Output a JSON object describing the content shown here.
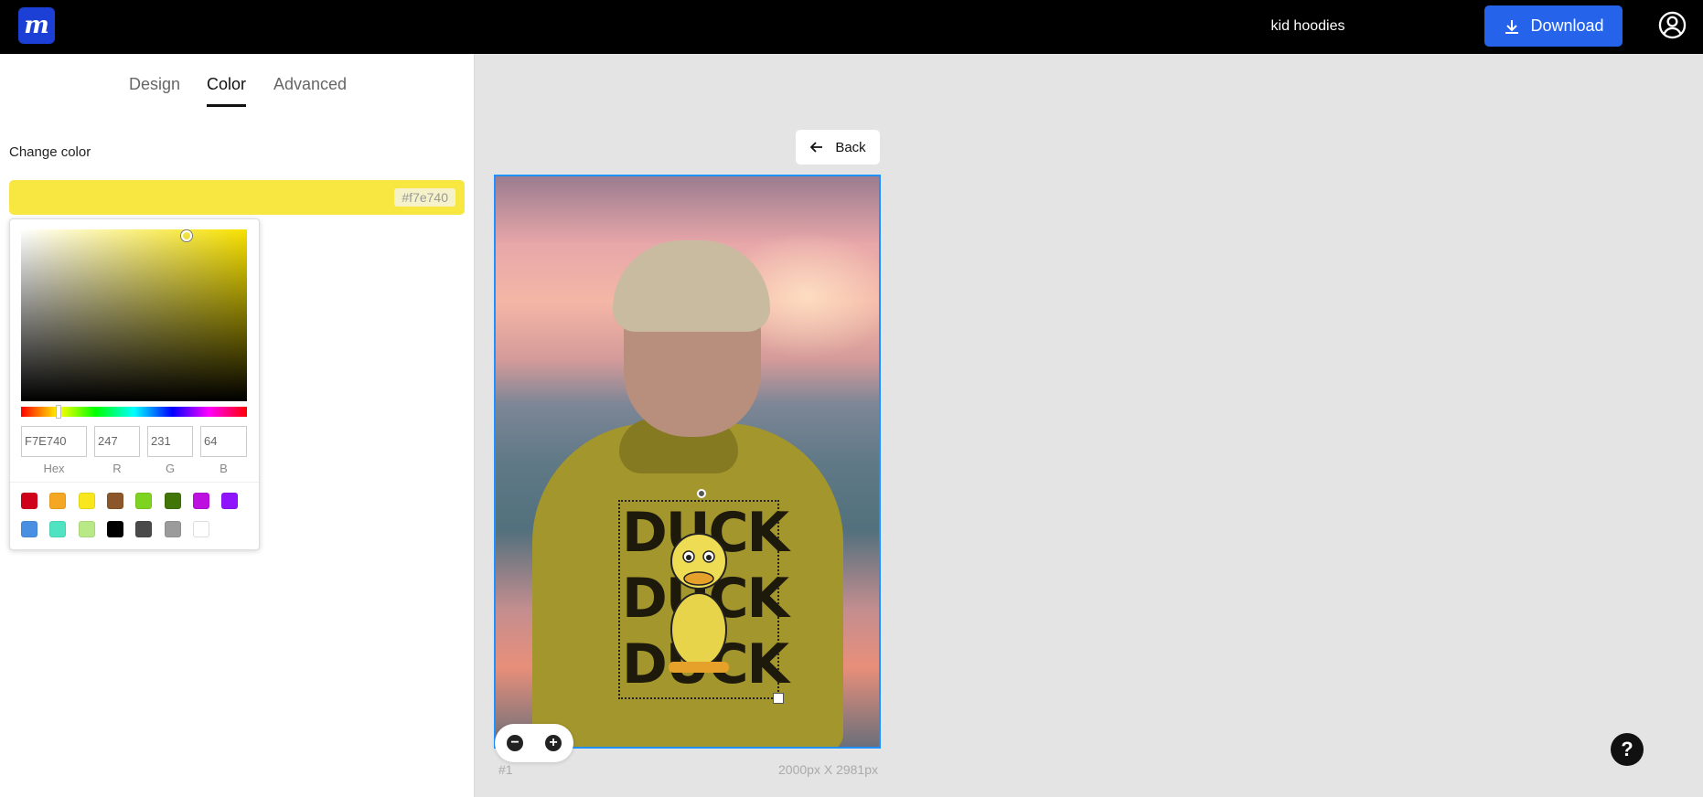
{
  "app": {
    "logo_letter": "m",
    "document_title": "kid hoodies"
  },
  "topbar": {
    "download_label": "Download"
  },
  "tabs": [
    {
      "label": "Design"
    },
    {
      "label": "Color"
    },
    {
      "label": "Advanced"
    }
  ],
  "color_panel": {
    "heading": "Change color",
    "current_hex": "#f7e740",
    "picker": {
      "hex_value": "F7E740",
      "r": "247",
      "g": "231",
      "b": "64",
      "labels": {
        "hex": "Hex",
        "r": "R",
        "g": "G",
        "b": "B"
      }
    },
    "swatches": [
      "#d0021b",
      "#f5a623",
      "#f8e71c",
      "#8b572a",
      "#7ed321",
      "#417505",
      "#bd10e0",
      "#9013fe",
      "#4a90e2",
      "#50e3c2",
      "#b8e986",
      "#000000",
      "#4a4a4a",
      "#9b9b9b",
      "#ffffff"
    ]
  },
  "canvas": {
    "back_label": "Back",
    "print_lines": [
      "DUCK",
      "DUCK",
      "DUCK"
    ],
    "page_number": "#1",
    "dimensions": "2000px X 2981px"
  },
  "help": {
    "label": "?"
  },
  "colors": {
    "accent": "#2563eb",
    "selection": "#1e90ff"
  }
}
